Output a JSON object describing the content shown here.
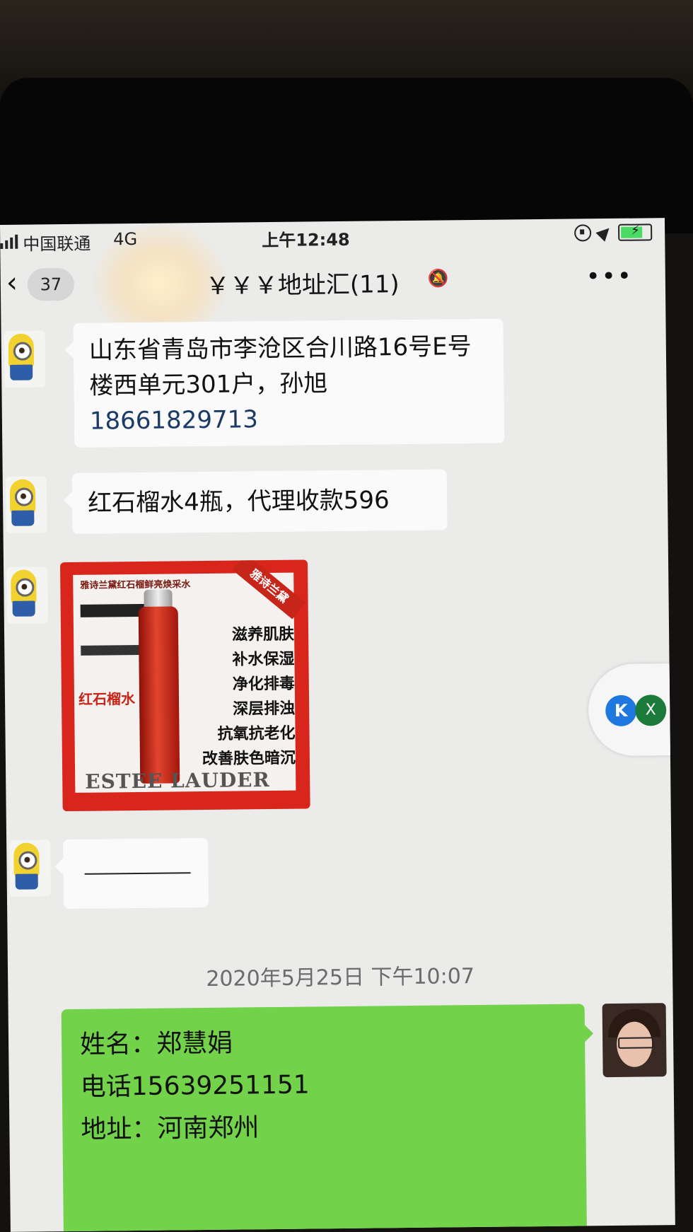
{
  "statusbar": {
    "carrier": "中国联通",
    "network": "4G",
    "time": "上午12:48"
  },
  "navbar": {
    "unread_count": "37",
    "title": "￥￥￥地址汇(11)",
    "more": "•••"
  },
  "messages": [
    {
      "sender": "minion",
      "address": "山东省青岛市李沧区合川路16号E号楼西单元301户，孙旭",
      "phone": "18661829713"
    },
    {
      "sender": "minion",
      "text": "红石榴水4瓶，代理收款596"
    },
    {
      "sender": "minion",
      "image": {
        "title": "雅诗兰黛红石榴鲜亮焕采水",
        "ribbon": "雅诗兰黛",
        "tag": "红石榴水",
        "benefits": [
          "滋养肌肤",
          "补水保湿",
          "净化排毒",
          "深层排浊",
          "抗氧抗老化",
          "改善肤色暗沉"
        ],
        "brand": "ESTEE LAUDER"
      }
    },
    {
      "sender": "minion",
      "text": "———————"
    }
  ],
  "timestamp": "2020年5月25日 下午10:07",
  "floating": {
    "btn1": "K",
    "btn2": "X"
  },
  "my_message": {
    "line1": "姓名：郑慧娟",
    "line2": "电话15639251151",
    "line3": "地址：河南郑州"
  },
  "colors": {
    "my_bubble": "#72d24a",
    "their_bubble": "#fafafa",
    "background": "#ebebea",
    "poster_frame": "#d9261c"
  }
}
